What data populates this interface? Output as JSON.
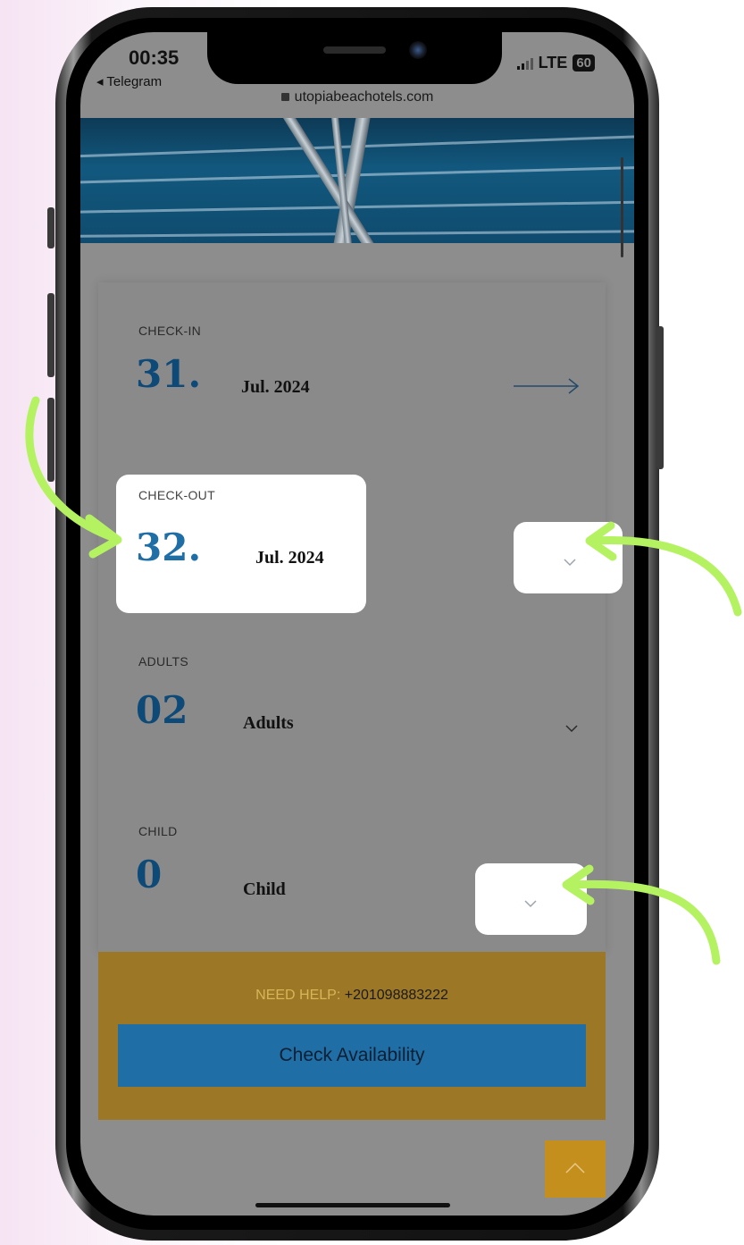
{
  "status_bar": {
    "time": "00:35",
    "back_app": "◂ Telegram",
    "network": "LTE",
    "battery": "60"
  },
  "browser": {
    "url": "utopiabeachotels.com"
  },
  "booking": {
    "checkin": {
      "label": "CHECK-IN",
      "day": "31.",
      "month_year": "Jul. 2024"
    },
    "checkout": {
      "label": "CHECK-OUT",
      "day": "32.",
      "month_year": "Jul. 2024"
    },
    "adults": {
      "label": "ADULTS",
      "count": "02",
      "unit": "Adults"
    },
    "child": {
      "label": "CHILD",
      "count": "0",
      "unit": "Child"
    }
  },
  "footer": {
    "help_prefix": "NEED HELP:",
    "help_phone": "+201098883222",
    "check_button": "Check Availability"
  },
  "colors": {
    "accent_blue": "#1f6ea6",
    "gold": "#9c7726",
    "annotation_green": "#b4f262",
    "number_blue": "#0d4a78"
  },
  "icons": [
    "arrow-right-icon",
    "chevron-down-icon",
    "chevron-up-icon",
    "lock-icon"
  ]
}
